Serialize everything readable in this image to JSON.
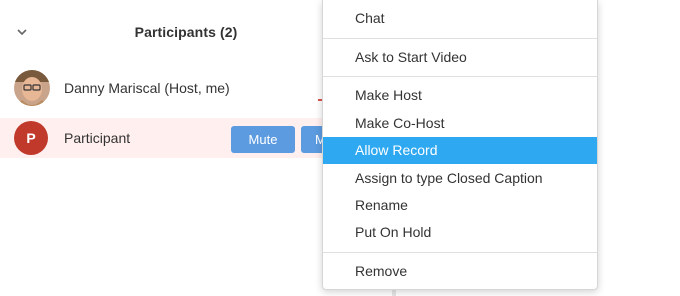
{
  "participants": {
    "title": "Participants (2)",
    "list": [
      {
        "name": "Danny Mariscal (Host, me)",
        "avatar": "photo"
      },
      {
        "name": "Participant",
        "avatar_letter": "P",
        "mute_label": "Mute",
        "more_label": "M"
      }
    ]
  },
  "context_menu": {
    "items": [
      {
        "label": "Chat"
      },
      {
        "label": "Ask to Start Video"
      },
      {
        "label": "Make Host"
      },
      {
        "label": "Make Co-Host"
      },
      {
        "label": "Allow Record",
        "highlighted": true
      },
      {
        "label": "Assign to type Closed Caption"
      },
      {
        "label": "Rename"
      },
      {
        "label": "Put On Hold"
      },
      {
        "label": "Remove"
      }
    ]
  },
  "colors": {
    "accent_blue": "#5c9be0",
    "menu_highlight": "#2ea8f0",
    "avatar_red": "#c0392b",
    "row_highlight": "#fff0ef"
  }
}
